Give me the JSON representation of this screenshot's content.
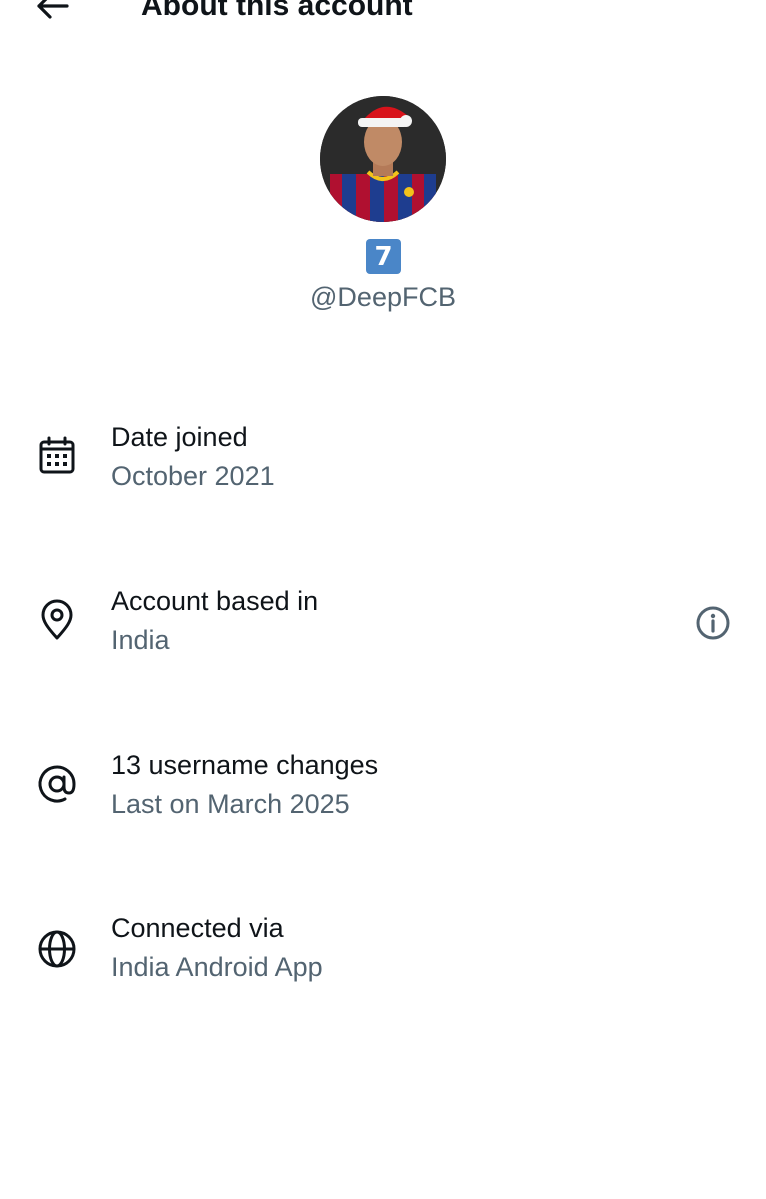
{
  "header": {
    "title": "About this account",
    "back_icon": "arrow-left-icon"
  },
  "profile": {
    "avatar_alt": "profile photo",
    "badge_emoji": "7",
    "badge_color": "#4a86c8",
    "handle": "@DeepFCB"
  },
  "rows": [
    {
      "icon": "calendar-icon",
      "title": "Date joined",
      "subtitle": "October 2021"
    },
    {
      "icon": "location-pin-icon",
      "title": "Account based in",
      "subtitle": "India",
      "action_icon": "info-icon"
    },
    {
      "icon": "at-sign-icon",
      "title": "13 username changes",
      "subtitle": "Last on March 2025"
    },
    {
      "icon": "globe-icon",
      "title": "Connected via",
      "subtitle": "India Android App"
    }
  ],
  "colors": {
    "text_primary": "#0f1419",
    "text_secondary": "#536471",
    "background": "#ffffff"
  }
}
